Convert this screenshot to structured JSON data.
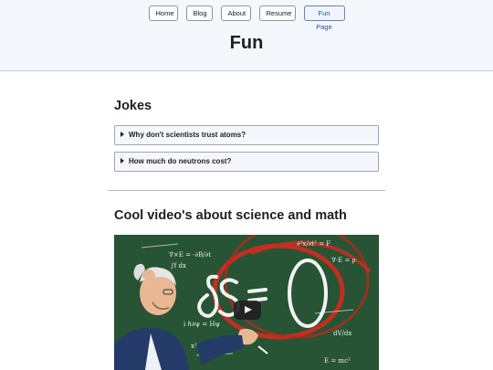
{
  "nav": {
    "items": [
      "Home",
      "Blog",
      "About",
      "Resume",
      "Fun Page"
    ],
    "active": "Fun Page"
  },
  "page": {
    "title": "Fun"
  },
  "jokes": {
    "heading": "Jokes",
    "items": [
      "Why don't scientists trust atoms?",
      "How much do neutrons cost?"
    ]
  },
  "videos": {
    "heading": "Cool video's about science and math"
  },
  "colors": {
    "header_bg": "#f4f7fc",
    "accent": "#2a4fa0",
    "chalkboard": "#2c5a3a",
    "chalk_red": "#d42a1f"
  }
}
